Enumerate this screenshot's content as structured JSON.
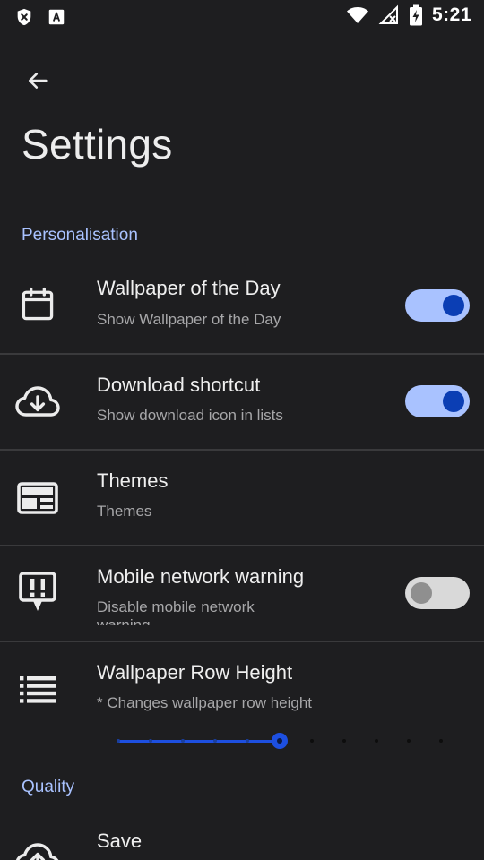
{
  "status_bar": {
    "time": "5:21",
    "left_icons": [
      "shield-x-icon",
      "font-a-icon"
    ],
    "right_icons": [
      "wifi-icon",
      "no-signal-icon",
      "battery-charging-icon"
    ]
  },
  "header": {
    "back_icon": "arrow-left-icon",
    "title": "Settings"
  },
  "sections": {
    "personalisation": {
      "title": "Personalisation"
    },
    "quality": {
      "title": "Quality"
    }
  },
  "settings": {
    "wallpaper_of_day": {
      "title": "Wallpaper of the Day",
      "summary": "Show Wallpaper of the Day",
      "icon": "calendar-icon",
      "enabled": true
    },
    "download_shortcut": {
      "title": "Download shortcut",
      "summary": "Show download icon in lists",
      "icon": "cloud-download-icon",
      "enabled": true
    },
    "themes": {
      "title": "Themes",
      "summary": "Themes",
      "icon": "dashboard-layout-icon"
    },
    "mobile_network_warning": {
      "title": "Mobile network warning",
      "summary": "Disable mobile network",
      "summary_cut": "warning",
      "icon": "alert-message-icon",
      "enabled": false
    },
    "wallpaper_row_height": {
      "title": "Wallpaper Row Height",
      "summary": "* Changes wallpaper row height",
      "icon": "list-icon",
      "slider_steps": 11,
      "slider_value_step": 5
    },
    "save": {
      "title": "Save",
      "icon": "cloud-upload-icon"
    }
  },
  "colors": {
    "background": "#1e1e20",
    "accent": "#a9c2ff",
    "toggle_knob_on": "#0b3eb4",
    "slider_active": "#1d4fe0"
  }
}
